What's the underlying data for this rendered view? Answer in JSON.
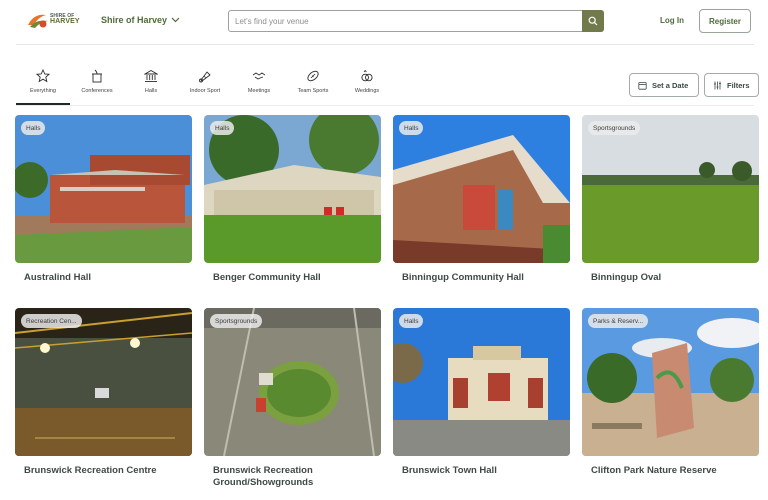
{
  "header": {
    "logo_text_small": "SHIRE OF",
    "logo_text_big": "HARVEY",
    "shire_selector": "Shire of Harvey",
    "search_placeholder": "Let's find your venue",
    "login_label": "Log In",
    "register_label": "Register"
  },
  "categories": [
    {
      "label": "Everything",
      "icon": "star-icon",
      "active": true
    },
    {
      "label": "Conferences",
      "icon": "podium-icon",
      "active": false
    },
    {
      "label": "Halls",
      "icon": "building-icon",
      "active": false
    },
    {
      "label": "Indoor Sport",
      "icon": "shuttlecock-icon",
      "active": false
    },
    {
      "label": "Meetings",
      "icon": "handshake-icon",
      "active": false
    },
    {
      "label": "Team Sports",
      "icon": "football-icon",
      "active": false
    },
    {
      "label": "Weddings",
      "icon": "rings-icon",
      "active": false
    }
  ],
  "actions": {
    "set_date_label": "Set a Date",
    "filters_label": "Filters"
  },
  "venues": [
    {
      "title": "Australind Hall",
      "tag": "Halls"
    },
    {
      "title": "Benger Community Hall",
      "tag": "Halls"
    },
    {
      "title": "Binningup Community Hall",
      "tag": "Halls"
    },
    {
      "title": "Binningup Oval",
      "tag": "Sportsgrounds"
    },
    {
      "title": "Brunswick Recreation Centre",
      "tag": "Recreation Cen..."
    },
    {
      "title": "Brunswick Recreation Ground/Showgrounds",
      "tag": "Sportsgrounds"
    },
    {
      "title": "Brunswick Town Hall",
      "tag": "Halls"
    },
    {
      "title": "Clifton Park Nature Reserve",
      "tag": "Parks & Reserv..."
    }
  ],
  "colors": {
    "brand_green": "#4e6a3a",
    "search_button": "#707a4a",
    "active_underline": "#1f2a25"
  }
}
